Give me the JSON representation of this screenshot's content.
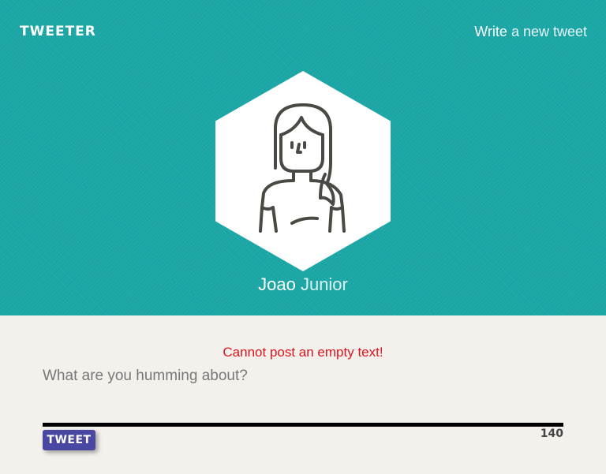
{
  "header": {
    "brand": "TWEETER",
    "write_link": {
      "bold": "Write",
      "rest": " a new tweet"
    }
  },
  "profile": {
    "first_name": "Joao",
    "last_name": "Junior",
    "avatar_icon": "user-avatar-icon"
  },
  "composer": {
    "error": "Cannot post an empty text!",
    "placeholder": "What are you humming about?",
    "value": "",
    "counter": "140",
    "button_label": "TWEET"
  },
  "colors": {
    "header_bg": "#1aa7a6",
    "page_bg": "#f4f1ec",
    "button_bg": "#4a47a3",
    "error_text": "#e0141e",
    "avatar_stroke": "#4a4a44"
  }
}
